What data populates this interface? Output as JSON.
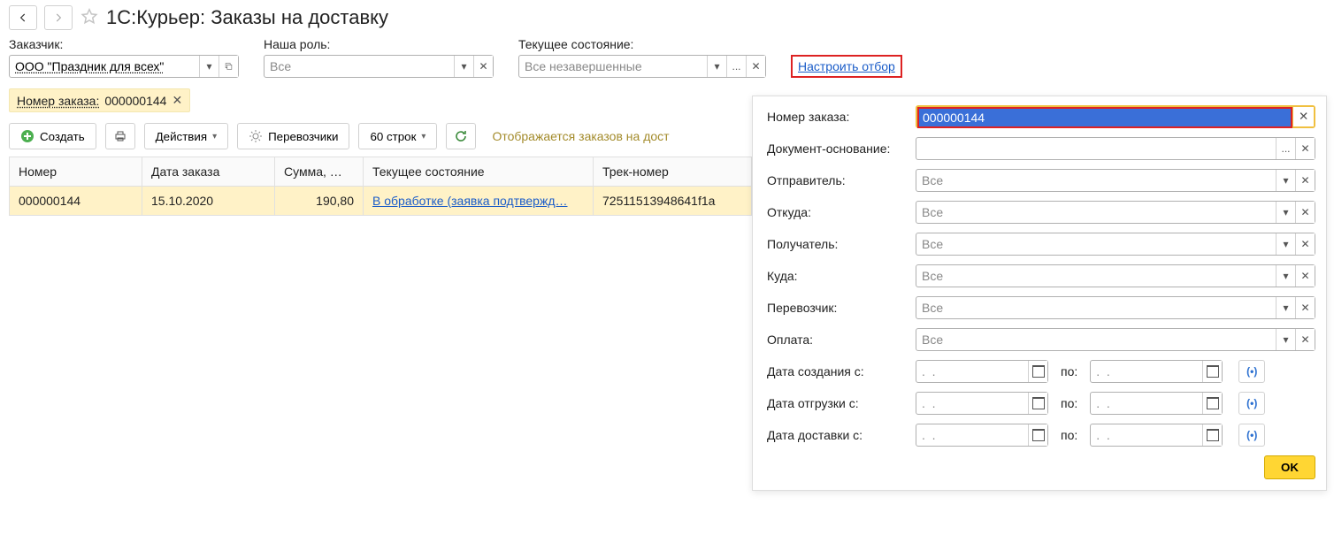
{
  "header": {
    "title": "1С:Курьер: Заказы на доставку"
  },
  "filters": {
    "customer_label": "Заказчик:",
    "customer_value": "ООО \"Праздник для всех\"",
    "role_label": "Наша роль:",
    "role_placeholder": "Все",
    "state_label": "Текущее состояние:",
    "state_placeholder": "Все незавершенные",
    "configure_link": "Настроить отбор"
  },
  "chip": {
    "label": "Номер заказа:",
    "value": "000000144"
  },
  "toolbar": {
    "create_label": "Создать",
    "actions_label": "Действия",
    "carriers_label": "Перевозчики",
    "rows_label": "60 строк",
    "status_text": "Отображается заказов на дост"
  },
  "grid": {
    "columns": {
      "number": "Номер",
      "date": "Дата заказа",
      "sum": "Сумма, …",
      "state": "Текущее состояние",
      "track": "Трек-номер"
    },
    "rows": [
      {
        "number": "000000144",
        "date": "15.10.2020",
        "sum": "190,80",
        "state": "В обработке (заявка подтвержд…",
        "track": "72511513948641f1a"
      }
    ]
  },
  "panel": {
    "order_label": "Номер заказа:",
    "order_value": "000000144",
    "basis_label": "Документ-основание:",
    "sender_label": "Отправитель:",
    "from_label": "Откуда:",
    "receiver_label": "Получатель:",
    "to_label": "Куда:",
    "carrier_label": "Перевозчик:",
    "payment_label": "Оплата:",
    "combo_placeholder": "Все",
    "date_created_label": "Дата создания с:",
    "date_ship_label": "Дата отгрузки с:",
    "date_delivery_label": "Дата доставки с:",
    "date_placeholder": ".  .",
    "date_to_label": "по:",
    "range_btn": "(•)",
    "ellipsis": "...",
    "ok_label": "OK"
  }
}
